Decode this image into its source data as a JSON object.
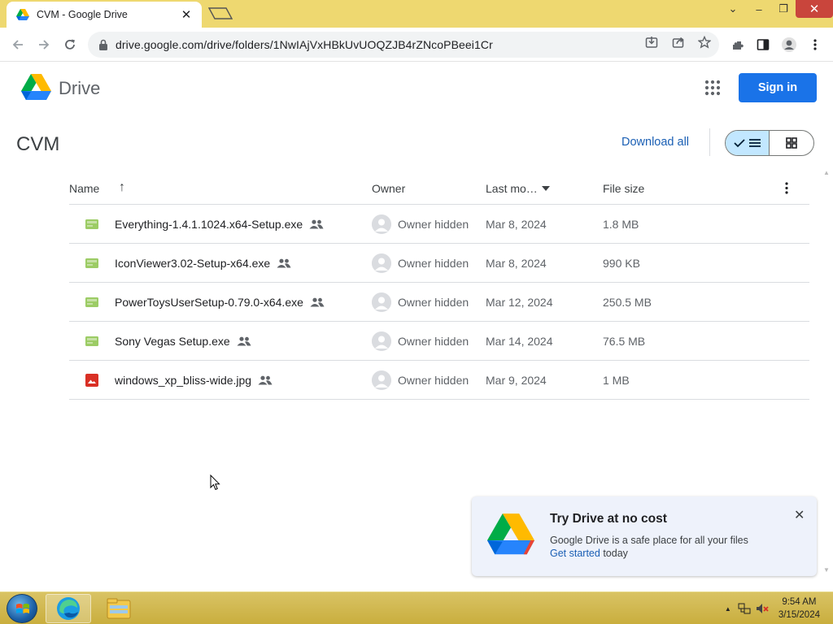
{
  "browser": {
    "tab_title": "CVM - Google Drive",
    "tab_close": "✕",
    "url": "drive.google.com/drive/folders/1NwIAjVxHBkUvUOQZJB4rZNcoPBeei1Cr",
    "window_controls": {
      "chevron": "⌄",
      "minimize": "–",
      "maximize": "❐",
      "close": "✕"
    }
  },
  "header": {
    "app_name": "Drive",
    "signin_label": "Sign in"
  },
  "folder": {
    "title": "CVM",
    "download_all_label": "Download all",
    "view_mode": "list"
  },
  "table": {
    "columns": {
      "name": "Name",
      "owner": "Owner",
      "last_modified": "Last mo…",
      "file_size": "File size"
    },
    "sort_arrow": "↑",
    "rows": [
      {
        "icon": "exe-icon",
        "name": "Everything-1.4.1.1024.x64-Setup.exe",
        "owner": "Owner hidden",
        "modified": "Mar 8, 2024",
        "size": "1.8 MB"
      },
      {
        "icon": "exe-icon",
        "name": "IconViewer3.02-Setup-x64.exe",
        "owner": "Owner hidden",
        "modified": "Mar 8, 2024",
        "size": "990 KB"
      },
      {
        "icon": "exe-icon",
        "name": "PowerToysUserSetup-0.79.0-x64.exe",
        "owner": "Owner hidden",
        "modified": "Mar 12, 2024",
        "size": "250.5 MB"
      },
      {
        "icon": "exe-icon",
        "name": "Sony Vegas Setup.exe",
        "owner": "Owner hidden",
        "modified": "Mar 14, 2024",
        "size": "76.5 MB"
      },
      {
        "icon": "image-icon",
        "name": "windows_xp_bliss-wide.jpg",
        "owner": "Owner hidden",
        "modified": "Mar 9, 2024",
        "size": "1 MB"
      }
    ]
  },
  "promo": {
    "title": "Try Drive at no cost",
    "body": "Google Drive is a safe place for all your files",
    "link": "Get started",
    "link_suffix": " today",
    "close": "✕"
  },
  "taskbar": {
    "time": "9:54 AM",
    "date": "3/15/2024"
  },
  "colors": {
    "accent_blue": "#1a73e8",
    "link_blue": "#1a5fb4",
    "chrome_frame": "#eed870",
    "selected_view": "#c2e7ff",
    "exe_icon": "#9ccc65",
    "image_icon": "#d93025"
  }
}
